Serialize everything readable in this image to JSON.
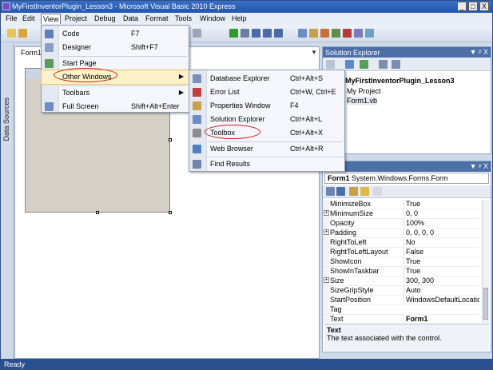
{
  "window": {
    "title": "MyFirstInventorPlugin_Lesson3 - Microsoft Visual Basic 2010 Express",
    "min_label": "_",
    "max_label": "□",
    "close_label": "X"
  },
  "menubar": {
    "items": [
      {
        "label": "File"
      },
      {
        "label": "Edit"
      },
      {
        "label": "View"
      },
      {
        "label": "Project"
      },
      {
        "label": "Debug"
      },
      {
        "label": "Data"
      },
      {
        "label": "Format"
      },
      {
        "label": "Tools"
      },
      {
        "label": "Window"
      },
      {
        "label": "Help"
      }
    ]
  },
  "leftstrip": {
    "label": "Data Sources"
  },
  "document": {
    "tab_label": "Form1",
    "dropdown_arrow": "▼"
  },
  "view_menu": {
    "items": [
      {
        "label": "Code",
        "shortcut": "F7",
        "icon": "code-icon"
      },
      {
        "label": "Designer",
        "shortcut": "Shift+F7",
        "icon": "designer-icon"
      },
      {
        "label": "Start Page",
        "shortcut": "",
        "icon": "start-page-icon"
      },
      {
        "label": "Other Windows",
        "shortcut": "",
        "icon": "",
        "submenu": "▶"
      },
      {
        "label": "Toolbars",
        "shortcut": "",
        "icon": "",
        "submenu": "▶"
      },
      {
        "label": "Full Screen",
        "shortcut": "Shift+Alt+Enter",
        "icon": "full-screen-icon"
      }
    ]
  },
  "other_windows_menu": {
    "items": [
      {
        "label": "Database Explorer",
        "shortcut": "Ctrl+Alt+S"
      },
      {
        "label": "Error List",
        "shortcut": "Ctrl+W, Ctrl+E"
      },
      {
        "label": "Properties Window",
        "shortcut": "F4"
      },
      {
        "label": "Solution Explorer",
        "shortcut": "Ctrl+Alt+L"
      },
      {
        "label": "Toolbox",
        "shortcut": "Ctrl+Alt+X"
      },
      {
        "label": "Web Browser",
        "shortcut": "Ctrl+Alt+R"
      },
      {
        "label": "Find Results",
        "shortcut": ""
      }
    ]
  },
  "solution_explorer": {
    "title": "Solution Explorer",
    "pin_buttons": "▼ ᵖ X",
    "tree": [
      {
        "label": "MyFirstInventorPlugin_Lesson3"
      },
      {
        "label": "My Project"
      },
      {
        "label": "Form1.vb"
      }
    ]
  },
  "properties": {
    "title": "ies",
    "pin_buttons": "▼ ᵖ X",
    "object_name": "Form1",
    "object_type": "System.Windows.Forms.Form",
    "rows": [
      {
        "name": "MinimizeBox",
        "value": "True",
        "expand": ""
      },
      {
        "name": "MinimumSize",
        "value": "0, 0",
        "expand": "⊞"
      },
      {
        "name": "Opacity",
        "value": "100%",
        "expand": ""
      },
      {
        "name": "Padding",
        "value": "0, 0, 0, 0",
        "expand": "⊞"
      },
      {
        "name": "RightToLeft",
        "value": "No",
        "expand": ""
      },
      {
        "name": "RightToLeftLayout",
        "value": "False",
        "expand": ""
      },
      {
        "name": "ShowIcon",
        "value": "True",
        "expand": ""
      },
      {
        "name": "ShowInTaskbar",
        "value": "True",
        "expand": ""
      },
      {
        "name": "Size",
        "value": "300, 300",
        "expand": "⊞"
      },
      {
        "name": "SizeGripStyle",
        "value": "Auto",
        "expand": ""
      },
      {
        "name": "StartPosition",
        "value": "WindowsDefaultLocation",
        "expand": ""
      },
      {
        "name": "Tag",
        "value": "",
        "expand": ""
      },
      {
        "name": "Text",
        "value": "Form1",
        "expand": ""
      }
    ],
    "description_title": "Text",
    "description_text": "The text associated with the control."
  },
  "status": {
    "text": "Ready"
  },
  "colors": {
    "highlight_oval": "#c0201f",
    "status_bar": "#2a4f8f"
  }
}
